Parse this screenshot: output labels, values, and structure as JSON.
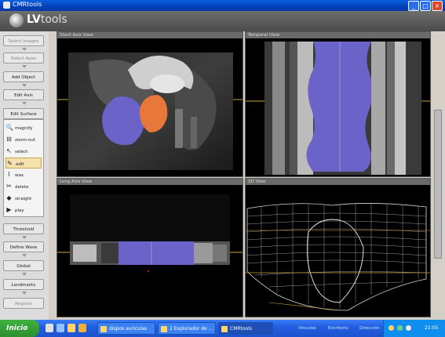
{
  "window": {
    "title": "CMRtools",
    "minimize_glyph": "_",
    "maximize_glyph": "□",
    "close_glyph": "×"
  },
  "app": {
    "logo_prefix": "LV",
    "logo_suffix": "tools"
  },
  "sidebar": {
    "buttons": [
      {
        "label": "Select Images",
        "enabled": false
      },
      {
        "label": "Select Apex",
        "enabled": false
      },
      {
        "label": "Add Object",
        "enabled": true
      },
      {
        "label": "Edit Axis",
        "enabled": true
      },
      {
        "label": "Edit Surface",
        "enabled": true
      }
    ],
    "tools": [
      {
        "label": "magnify",
        "icon": "magnifier-icon",
        "glyph": "🔍",
        "selected": false
      },
      {
        "label": "zoom-out",
        "icon": "zoom-out-icon",
        "glyph": "⊟",
        "selected": false
      },
      {
        "label": "select",
        "icon": "pointer-icon",
        "glyph": "↖",
        "selected": false
      },
      {
        "label": "edit",
        "icon": "edit-icon",
        "glyph": "✎",
        "selected": true
      },
      {
        "label": "wax",
        "icon": "wax-icon",
        "glyph": "⌇",
        "selected": false
      },
      {
        "label": "delete",
        "icon": "delete-icon",
        "glyph": "✂",
        "selected": false
      },
      {
        "label": "straight",
        "icon": "straight-icon",
        "glyph": "◆",
        "selected": false
      },
      {
        "label": "play",
        "icon": "play-icon",
        "glyph": "▶",
        "selected": false
      }
    ],
    "bottom_buttons": [
      {
        "label": "Threshold",
        "enabled": true
      },
      {
        "label": "Define Wave",
        "enabled": true
      },
      {
        "label": "Global",
        "enabled": true
      },
      {
        "label": "Landmarks",
        "enabled": true
      },
      {
        "label": "Regions",
        "enabled": false
      }
    ]
  },
  "views": {
    "short_axis": {
      "title": "Short Axis View"
    },
    "temporal": {
      "title": "Temporal View"
    },
    "long_axis": {
      "title": "Long Axis View"
    },
    "three_d": {
      "title": "3D View"
    }
  },
  "colors": {
    "lv_overlay": "#6b63c8",
    "rv_overlay": "#e8783a",
    "titlebar": "#0a5fe0",
    "taskbar": "#225ee0"
  },
  "taskbar": {
    "start_label": "Inicio",
    "tasks": [
      {
        "label": "dispos auriculas",
        "active": false
      },
      {
        "label": "2 Explorador de ...",
        "active": false
      },
      {
        "label": "CMRtools",
        "active": true
      }
    ],
    "tray_items": [
      "Vínculos",
      "Escritorio",
      "Dirección"
    ],
    "clock": "21:05"
  }
}
